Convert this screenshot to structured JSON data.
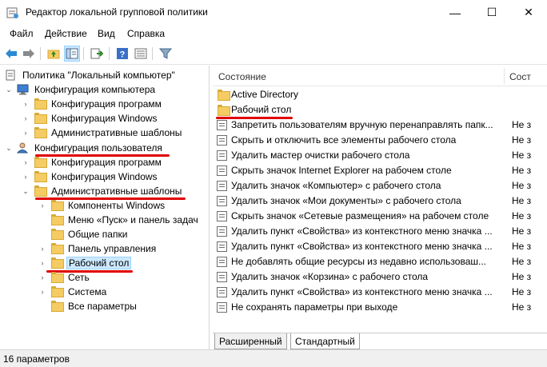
{
  "window": {
    "title": "Редактор локальной групповой политики",
    "controls": {
      "minimize": "—",
      "maximize": "☐",
      "close": "✕"
    }
  },
  "menu": [
    "Файл",
    "Действие",
    "Вид",
    "Справка"
  ],
  "toolbar": {
    "icons": [
      "back-arrow-icon",
      "forward-arrow-icon",
      "up-folder-icon",
      "show-hide-tree-icon",
      "export-list-icon",
      "help-icon",
      "properties-icon",
      "filter-icon"
    ]
  },
  "tree": {
    "root": "Политика \"Локальный компьютер\"",
    "computer_config": "Конфигурация компьютера",
    "computer_children": [
      "Конфигурация программ",
      "Конфигурация Windows",
      "Административные шаблоны"
    ],
    "user_config": "Конфигурация пользователя",
    "user_children": [
      "Конфигурация программ",
      "Конфигурация Windows",
      "Административные шаблоны"
    ],
    "admin_templates_children": [
      "Компоненты Windows",
      "Меню «Пуск» и панель задач",
      "Общие папки",
      "Панель управления",
      "Рабочий стол",
      "Сеть",
      "Система",
      "Все параметры"
    ],
    "selected": "Рабочий стол"
  },
  "list": {
    "columns": {
      "name": "Состояние",
      "state": "Сост"
    },
    "folders": [
      "Active Directory",
      "Рабочий стол"
    ],
    "settings": [
      {
        "name": "Запретить пользователям вручную перенаправлять папк...",
        "state": "Не з"
      },
      {
        "name": "Скрыть и отключить все элементы рабочего стола",
        "state": "Не з"
      },
      {
        "name": "Удалить мастер очистки рабочего стола",
        "state": "Не з"
      },
      {
        "name": "Скрыть значок Internet Explorer на рабочем столе",
        "state": "Не з"
      },
      {
        "name": "Удалить значок «Компьютер» с рабочего стола",
        "state": "Не з"
      },
      {
        "name": "Удалить значок «Мои документы» с рабочего стола",
        "state": "Не з"
      },
      {
        "name": "Скрыть значок «Сетевые размещения» на рабочем столе",
        "state": "Не з"
      },
      {
        "name": "Удалить пункт «Свойства» из контекстного меню значка ...",
        "state": "Не з"
      },
      {
        "name": "Удалить пункт «Свойства» из контекстного меню значка ...",
        "state": "Не з"
      },
      {
        "name": "Не добавлять общие ресурсы из недавно использоваш...",
        "state": "Не з"
      },
      {
        "name": "Удалить значок «Корзина» с рабочего стола",
        "state": "Не з"
      },
      {
        "name": "Удалить пункт «Свойства» из контекстного меню значка ...",
        "state": "Не з"
      },
      {
        "name": "Не сохранять параметры при выходе",
        "state": "Не з"
      }
    ]
  },
  "tabs": [
    "Расширенный",
    "Стандартный"
  ],
  "status": "16 параметров",
  "colors": {
    "highlight": "#e00000",
    "selection": "#cce8ff",
    "folder": "#f4cc63"
  }
}
